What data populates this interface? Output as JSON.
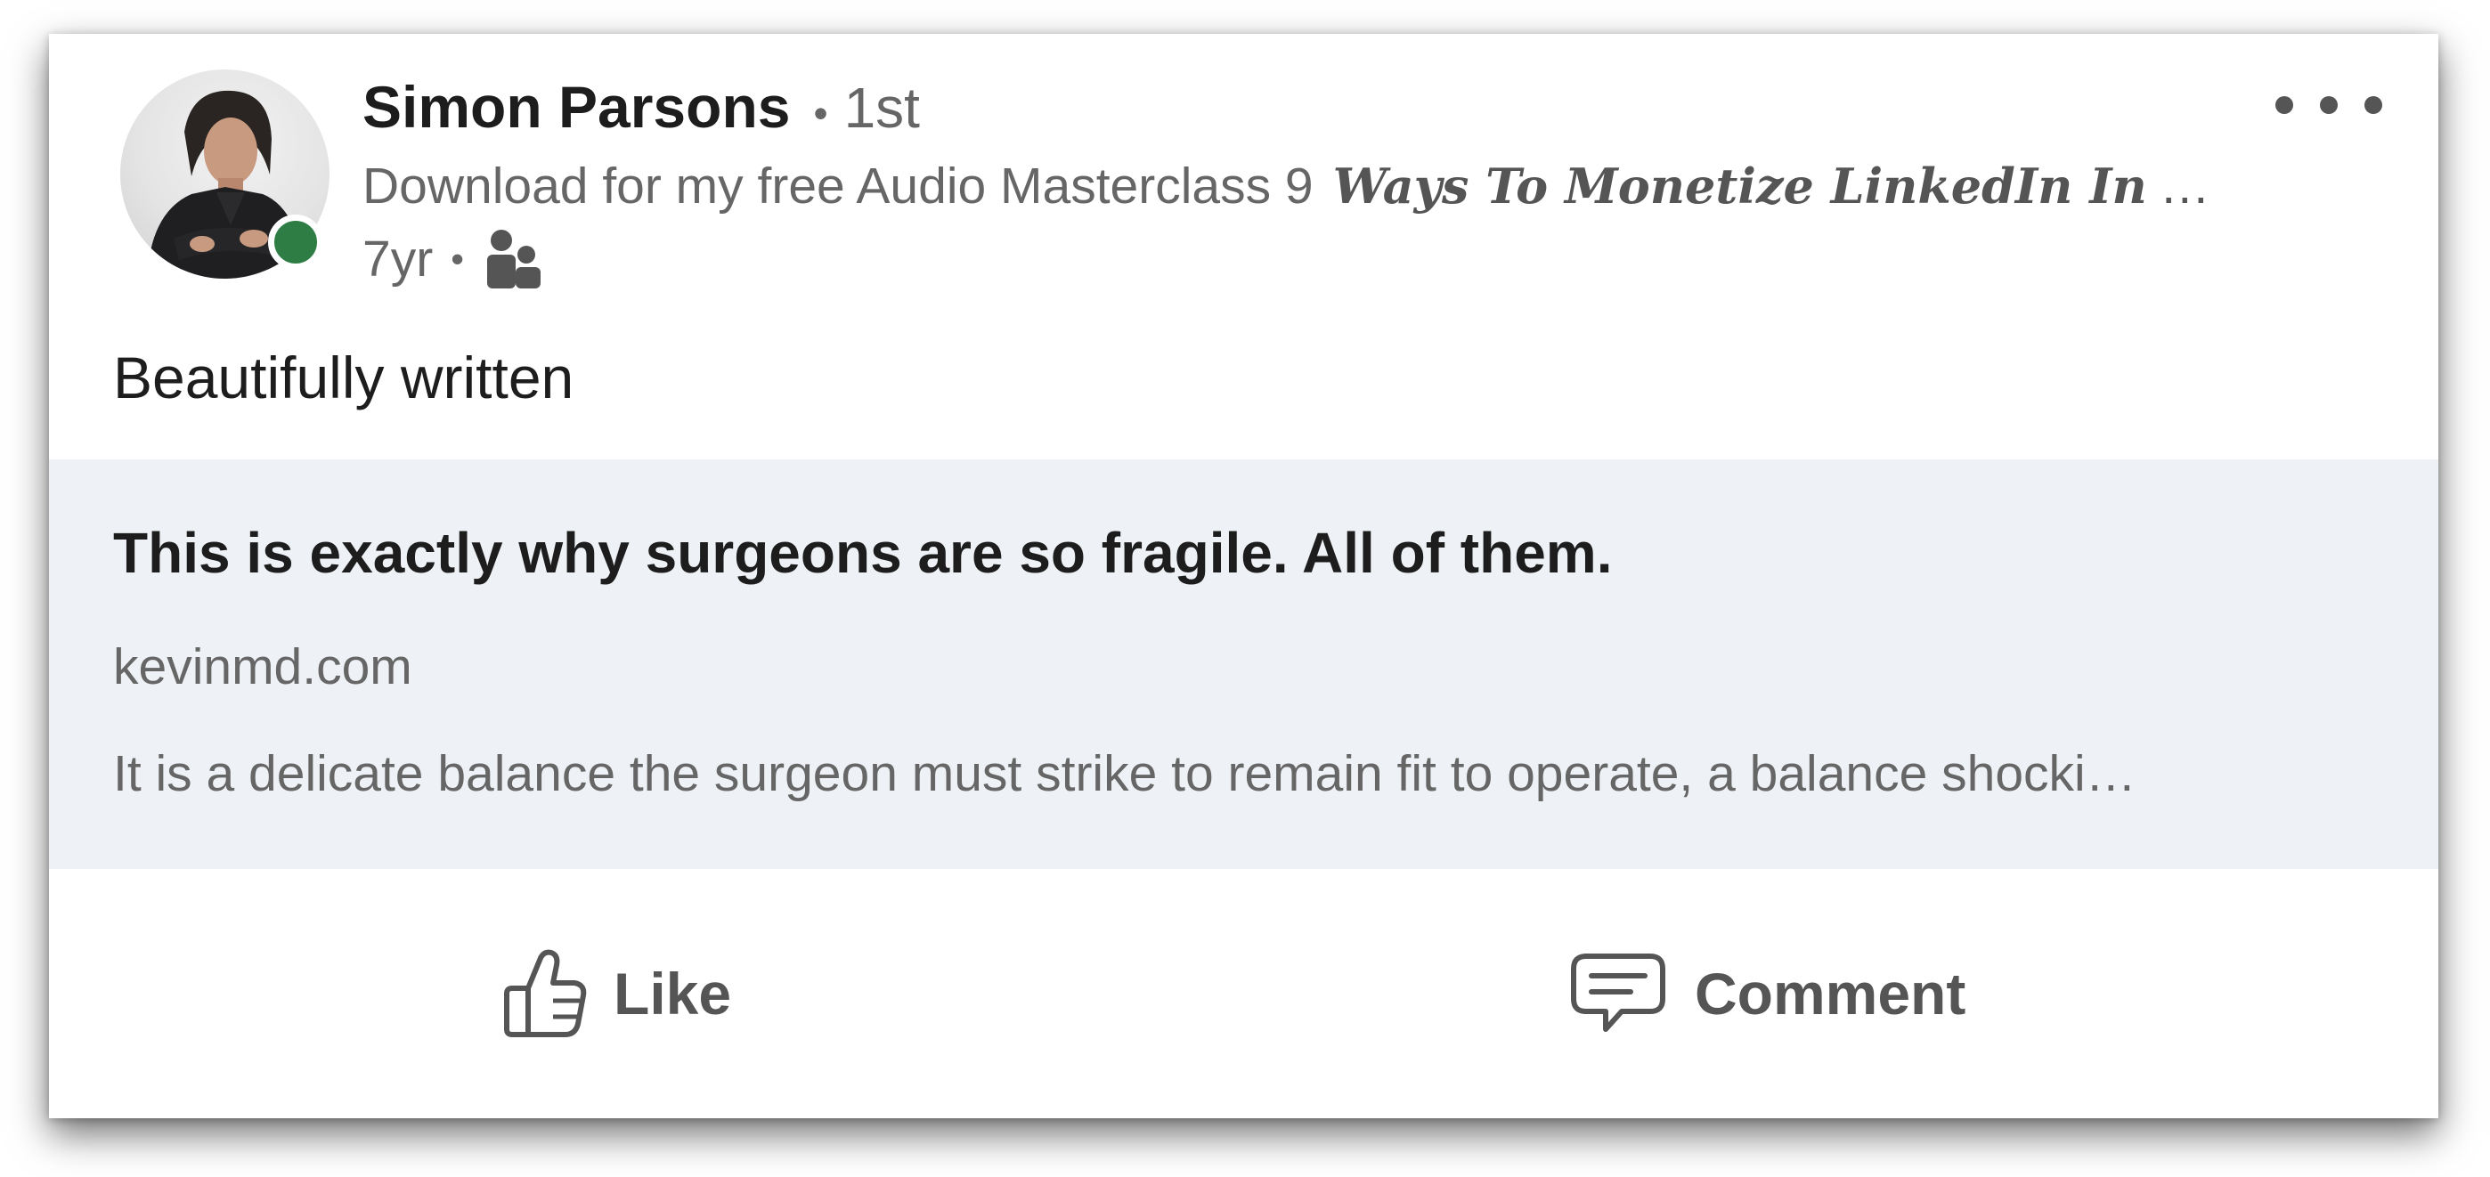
{
  "post": {
    "author": {
      "name": "Simon Parsons",
      "connection_separator": "•",
      "connection_degree": "1st",
      "headline": "Download for my free Audio Masterclass 9",
      "headline_emphasis": "Ways To Monetize LinkedIn In",
      "headline_ellipsis": "…",
      "online_status_color": "#2e7d45"
    },
    "meta": {
      "time_ago": "7yr",
      "separator": "•",
      "audience_icon": "connections-icon"
    },
    "commentary": "Beautifully written",
    "link_preview": {
      "title": "This is exactly why surgeons are so fragile. All of them.",
      "domain": "kevinmd.com",
      "description": "It is a delicate balance the surgeon must strike to remain fit to operate, a balance shocki…",
      "background_color": "#eef2f6"
    },
    "actions": {
      "like_label": "Like",
      "comment_label": "Comment"
    },
    "menu_icon": "more-options-icon"
  }
}
